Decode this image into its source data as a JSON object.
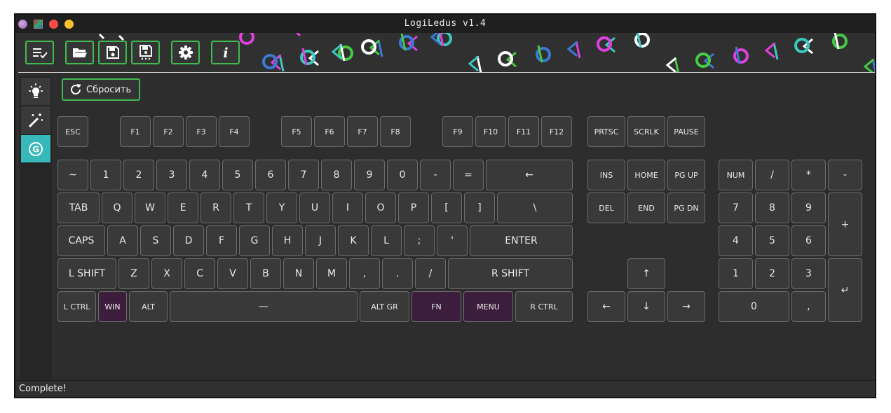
{
  "window": {
    "title": "LogiLedus v1.4",
    "status": "Complete!",
    "reset_label": "Сбросить"
  },
  "toolbar": {
    "buttons": [
      "list-check-icon",
      "folder-open-icon",
      "save-icon",
      "save-as-icon",
      "gear-icon",
      "info-icon"
    ]
  },
  "sidebar": {
    "items": [
      "lightbulb-icon",
      "magic-wand-icon",
      "g-key-icon"
    ],
    "active": 2
  },
  "colors": {
    "accent_green": "#3fbb52",
    "active_teal": "#37b9b9",
    "highlight_purple": "#3c1d3c"
  },
  "keys": [
    {
      "id": "esc",
      "label": "ESC"
    },
    {
      "id": "f1",
      "label": "F1"
    },
    {
      "id": "f2",
      "label": "F2"
    },
    {
      "id": "f3",
      "label": "F3"
    },
    {
      "id": "f4",
      "label": "F4"
    },
    {
      "id": "f5",
      "label": "F5"
    },
    {
      "id": "f6",
      "label": "F6"
    },
    {
      "id": "f7",
      "label": "F7"
    },
    {
      "id": "f8",
      "label": "F8"
    },
    {
      "id": "f9",
      "label": "F9"
    },
    {
      "id": "f10",
      "label": "F10"
    },
    {
      "id": "f11",
      "label": "F11"
    },
    {
      "id": "f12",
      "label": "F12"
    },
    {
      "id": "prtsc",
      "label": "PRTSC"
    },
    {
      "id": "scrlk",
      "label": "SCRLK"
    },
    {
      "id": "pause",
      "label": "PAUSE"
    },
    {
      "id": "tilde",
      "label": "~"
    },
    {
      "id": "d1",
      "label": "1"
    },
    {
      "id": "d2",
      "label": "2"
    },
    {
      "id": "d3",
      "label": "3"
    },
    {
      "id": "d4",
      "label": "4"
    },
    {
      "id": "d5",
      "label": "5"
    },
    {
      "id": "d6",
      "label": "6"
    },
    {
      "id": "d7",
      "label": "7"
    },
    {
      "id": "d8",
      "label": "8"
    },
    {
      "id": "d9",
      "label": "9"
    },
    {
      "id": "d0",
      "label": "0"
    },
    {
      "id": "minus",
      "label": "-"
    },
    {
      "id": "equals",
      "label": "="
    },
    {
      "id": "backspace",
      "label": "←"
    },
    {
      "id": "ins",
      "label": "INS"
    },
    {
      "id": "home",
      "label": "HOME"
    },
    {
      "id": "pgup",
      "label": "PG UP"
    },
    {
      "id": "num",
      "label": "NUM"
    },
    {
      "id": "np_div",
      "label": "/"
    },
    {
      "id": "np_mul",
      "label": "*"
    },
    {
      "id": "np_sub",
      "label": "-"
    },
    {
      "id": "tab",
      "label": "TAB"
    },
    {
      "id": "q",
      "label": "Q"
    },
    {
      "id": "w",
      "label": "W"
    },
    {
      "id": "e",
      "label": "E"
    },
    {
      "id": "r",
      "label": "R"
    },
    {
      "id": "t",
      "label": "T"
    },
    {
      "id": "y",
      "label": "Y"
    },
    {
      "id": "u",
      "label": "U"
    },
    {
      "id": "i",
      "label": "I"
    },
    {
      "id": "o",
      "label": "O"
    },
    {
      "id": "p",
      "label": "P"
    },
    {
      "id": "lbracket",
      "label": "["
    },
    {
      "id": "rbracket",
      "label": "]"
    },
    {
      "id": "backslash",
      "label": "\\"
    },
    {
      "id": "del",
      "label": "DEL"
    },
    {
      "id": "end",
      "label": "END"
    },
    {
      "id": "pgdn",
      "label": "PG DN"
    },
    {
      "id": "np7",
      "label": "7"
    },
    {
      "id": "np8",
      "label": "8"
    },
    {
      "id": "np9",
      "label": "9"
    },
    {
      "id": "np_add",
      "label": "+"
    },
    {
      "id": "caps",
      "label": "CAPS"
    },
    {
      "id": "a",
      "label": "A"
    },
    {
      "id": "s",
      "label": "S"
    },
    {
      "id": "d",
      "label": "D"
    },
    {
      "id": "f",
      "label": "F"
    },
    {
      "id": "g",
      "label": "G"
    },
    {
      "id": "h",
      "label": "H"
    },
    {
      "id": "j",
      "label": "J"
    },
    {
      "id": "k",
      "label": "K"
    },
    {
      "id": "l",
      "label": "L"
    },
    {
      "id": "semicolon",
      "label": ";"
    },
    {
      "id": "quote",
      "label": "'"
    },
    {
      "id": "enter",
      "label": "ENTER"
    },
    {
      "id": "np4",
      "label": "4"
    },
    {
      "id": "np5",
      "label": "5"
    },
    {
      "id": "np6",
      "label": "6"
    },
    {
      "id": "lshift",
      "label": "L SHIFT"
    },
    {
      "id": "z",
      "label": "Z"
    },
    {
      "id": "x",
      "label": "X"
    },
    {
      "id": "c",
      "label": "C"
    },
    {
      "id": "v",
      "label": "V"
    },
    {
      "id": "b",
      "label": "B"
    },
    {
      "id": "n",
      "label": "N"
    },
    {
      "id": "m",
      "label": "M"
    },
    {
      "id": "comma",
      "label": ","
    },
    {
      "id": "period",
      "label": "."
    },
    {
      "id": "slash",
      "label": "/"
    },
    {
      "id": "rshift",
      "label": "R SHIFT"
    },
    {
      "id": "up",
      "label": "↑"
    },
    {
      "id": "np1",
      "label": "1"
    },
    {
      "id": "np2",
      "label": "2"
    },
    {
      "id": "np3",
      "label": "3"
    },
    {
      "id": "np_enter",
      "label": "↵"
    },
    {
      "id": "lctrl",
      "label": "L CTRL"
    },
    {
      "id": "win",
      "label": "WIN",
      "highlight": true
    },
    {
      "id": "alt",
      "label": "ALT"
    },
    {
      "id": "space",
      "label": "—"
    },
    {
      "id": "altgr",
      "label": "ALT GR"
    },
    {
      "id": "fn",
      "label": "FN",
      "highlight": true
    },
    {
      "id": "menu",
      "label": "MENU",
      "highlight": true
    },
    {
      "id": "rctrl",
      "label": "R CTRL"
    },
    {
      "id": "left",
      "label": "←"
    },
    {
      "id": "down",
      "label": "↓"
    },
    {
      "id": "right",
      "label": "→"
    },
    {
      "id": "np0",
      "label": "0"
    },
    {
      "id": "np_dec",
      "label": ","
    }
  ]
}
